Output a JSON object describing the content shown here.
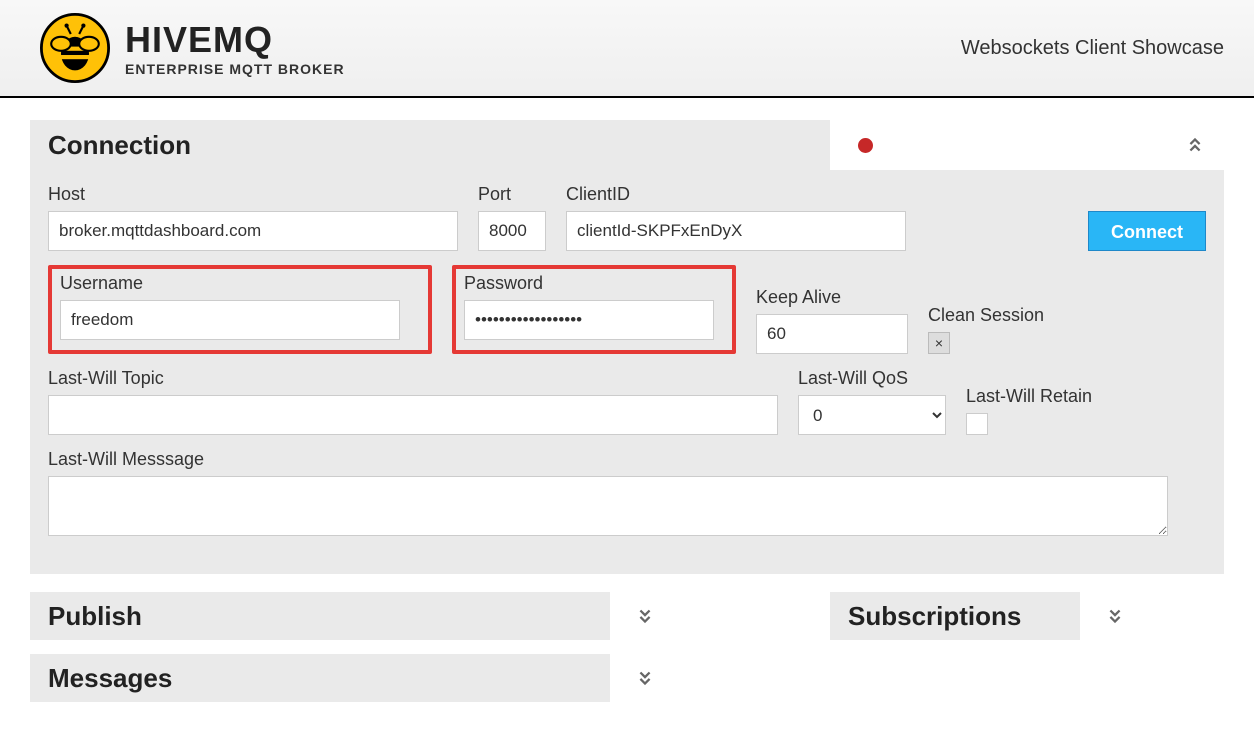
{
  "header": {
    "brand": "HIVEMQ",
    "subtitle": "ENTERPRISE MQTT BROKER",
    "showcase": "Websockets Client Showcase"
  },
  "connection": {
    "title": "Connection",
    "status_color": "#c62828",
    "host_label": "Host",
    "host_value": "broker.mqttdashboard.com",
    "port_label": "Port",
    "port_value": "8000",
    "clientid_label": "ClientID",
    "clientid_value": "clientId-SKPFxEnDyX",
    "connect_label": "Connect",
    "username_label": "Username",
    "username_value": "freedom",
    "password_label": "Password",
    "password_value": "••••••••••••••••••",
    "keepalive_label": "Keep Alive",
    "keepalive_value": "60",
    "cleansession_label": "Clean Session",
    "cleansession_checked": true,
    "lwtopic_label": "Last-Will Topic",
    "lwtopic_value": "",
    "lwqos_label": "Last-Will QoS",
    "lwqos_value": "0",
    "lwretain_label": "Last-Will Retain",
    "lwretain_checked": false,
    "lwmsg_label": "Last-Will Messsage",
    "lwmsg_value": ""
  },
  "panels": {
    "publish": "Publish",
    "subscriptions": "Subscriptions",
    "messages": "Messages"
  }
}
